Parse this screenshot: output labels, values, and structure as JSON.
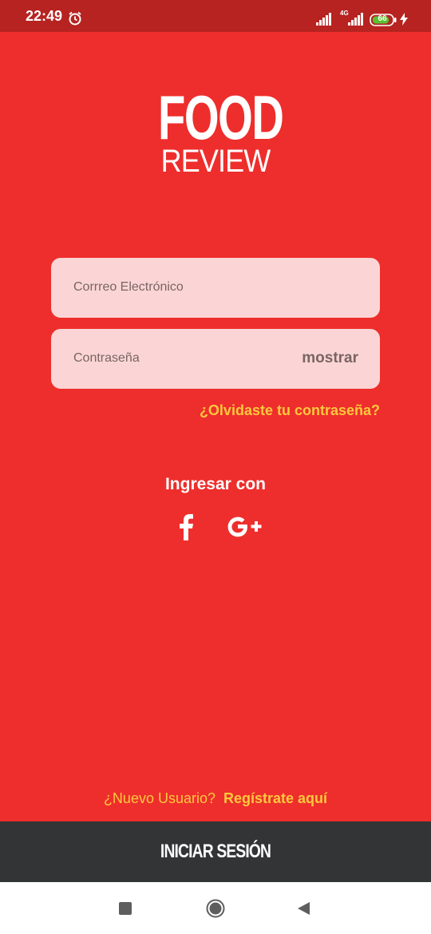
{
  "status_bar": {
    "time": "22:49",
    "network": "4G",
    "battery": "66",
    "icons": [
      "alarm-icon",
      "signal-icon",
      "battery-icon",
      "charging-bolt-icon"
    ]
  },
  "logo": {
    "line1": "FOOD",
    "line2": "REVIEW"
  },
  "form": {
    "email_placeholder": "Corrreo Electrónico",
    "password_placeholder": "Contraseña",
    "show_password_label": "mostrar",
    "forgot_password_label": "¿Olvidaste tu contraseña?"
  },
  "social": {
    "title": "Ingresar con",
    "providers": [
      "facebook-icon",
      "google-plus-icon"
    ]
  },
  "signup": {
    "question": "¿Nuevo Usuario?",
    "link": "Regístrate aquí"
  },
  "login_button": {
    "label": "INICIAR SESIÓN"
  },
  "colors": {
    "background": "#ee2e2c",
    "status_bar": "#b62320",
    "field_background": "#fbd5d5",
    "accent_yellow": "#fdc83d",
    "login_bar": "#323436"
  }
}
